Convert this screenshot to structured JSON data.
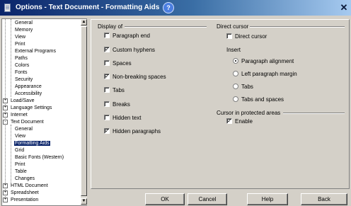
{
  "window": {
    "title": "Options - Text Document - Formatting Aids"
  },
  "tree": {
    "items": [
      {
        "label": "General",
        "level": 2,
        "selected": false
      },
      {
        "label": "Memory",
        "level": 2,
        "selected": false
      },
      {
        "label": "View",
        "level": 2,
        "selected": false
      },
      {
        "label": "Print",
        "level": 2,
        "selected": false
      },
      {
        "label": "External Programs",
        "level": 2,
        "selected": false
      },
      {
        "label": "Paths",
        "level": 2,
        "selected": false
      },
      {
        "label": "Colors",
        "level": 2,
        "selected": false
      },
      {
        "label": "Fonts",
        "level": 2,
        "selected": false
      },
      {
        "label": "Security",
        "level": 2,
        "selected": false
      },
      {
        "label": "Appearance",
        "level": 2,
        "selected": false
      },
      {
        "label": "Accessibility",
        "level": 2,
        "selected": false
      },
      {
        "label": "Load/Save",
        "level": 1,
        "expander": "+",
        "selected": false
      },
      {
        "label": "Language Settings",
        "level": 1,
        "expander": "+",
        "selected": false
      },
      {
        "label": "Internet",
        "level": 1,
        "expander": "+",
        "selected": false
      },
      {
        "label": "Text Document",
        "level": 1,
        "expander": "-",
        "selected": false
      },
      {
        "label": "General",
        "level": 2,
        "selected": false
      },
      {
        "label": "View",
        "level": 2,
        "selected": false
      },
      {
        "label": "Formatting Aids",
        "level": 2,
        "selected": true
      },
      {
        "label": "Grid",
        "level": 2,
        "selected": false
      },
      {
        "label": "Basic Fonts (Western)",
        "level": 2,
        "selected": false
      },
      {
        "label": "Print",
        "level": 2,
        "selected": false
      },
      {
        "label": "Table",
        "level": 2,
        "selected": false
      },
      {
        "label": "Changes",
        "level": 2,
        "selected": false
      },
      {
        "label": "HTML Document",
        "level": 1,
        "expander": "+",
        "selected": false
      },
      {
        "label": "Spreadsheet",
        "level": 1,
        "expander": "+",
        "selected": false
      },
      {
        "label": "Presentation",
        "level": 1,
        "expander": "+",
        "selected": false
      }
    ]
  },
  "display_of": {
    "title": "Display of",
    "options": [
      {
        "label": "Paragraph end",
        "checked": false
      },
      {
        "label": "Custom hyphens",
        "checked": true
      },
      {
        "label": "Spaces",
        "checked": false
      },
      {
        "label": "Non-breaking spaces",
        "checked": true
      },
      {
        "label": "Tabs",
        "checked": false
      },
      {
        "label": "Breaks",
        "checked": false
      },
      {
        "label": "Hidden text",
        "checked": false
      },
      {
        "label": "Hidden paragraphs",
        "checked": true
      }
    ]
  },
  "direct_cursor": {
    "title": "Direct cursor",
    "checkbox": {
      "label": "Direct cursor",
      "checked": false
    },
    "insert_label": "Insert",
    "radios": [
      {
        "label": "Paragraph alignment",
        "selected": true
      },
      {
        "label": "Left paragraph margin",
        "selected": false
      },
      {
        "label": "Tabs",
        "selected": false
      },
      {
        "label": "Tabs and spaces",
        "selected": false
      }
    ]
  },
  "protected_areas": {
    "title": "Cursor in protected areas",
    "checkbox": {
      "label": "Enable",
      "checked": true
    }
  },
  "buttons": {
    "ok": "OK",
    "cancel": "Cancel",
    "help": "Help",
    "back": "Back"
  },
  "checkmark_glyph": "✓"
}
